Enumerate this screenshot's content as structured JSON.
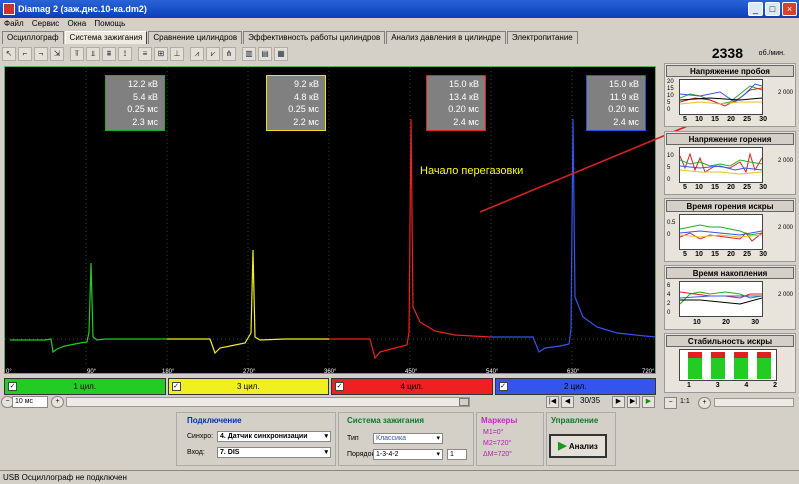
{
  "window": {
    "title": "Diamag 2 (заж.днс.10-ка.dm2)",
    "icon": "app-icon"
  },
  "menu": [
    "Файл",
    "Сервис",
    "Окна",
    "Помощь"
  ],
  "tabs": [
    {
      "label": "Осциллограф",
      "active": false
    },
    {
      "label": "Система зажигания",
      "active": true
    },
    {
      "label": "Сравнение цилиндров",
      "active": false
    },
    {
      "label": "Эффективность работы цилиндров",
      "active": false
    },
    {
      "label": "Анализ давления в цилиндре",
      "active": false
    },
    {
      "label": "Электропитание",
      "active": false
    }
  ],
  "rpm": {
    "value": "2338",
    "unit": "об./мин."
  },
  "scope": {
    "annotation": "Начало перегазовки",
    "info_boxes": [
      {
        "lines": [
          "12.2 кВ",
          "5.4 кВ",
          "0.25 мс",
          "2.3 мс"
        ],
        "border": "#1faa1f"
      },
      {
        "lines": [
          "9.2 кВ",
          "4.8 кВ",
          "0.25 мс",
          "2.2 мс"
        ],
        "border": "#e8e020"
      },
      {
        "lines": [
          "15.0 кВ",
          "13.4 кВ",
          "0.20 мс",
          "2.4 мс"
        ],
        "border": "#e02020"
      },
      {
        "lines": [
          "15.0 кВ",
          "11.9 кВ",
          "0.20 мс",
          "2.4 мс"
        ],
        "border": "#3050e0"
      }
    ],
    "x_ticks": [
      "0°",
      "90°",
      "180°",
      "270°",
      "360°",
      "450°",
      "540°",
      "630°",
      "720°"
    ]
  },
  "cylinders": [
    {
      "label": "1 цил.",
      "color": "#22cc22",
      "checked": "✓"
    },
    {
      "label": "3 цил.",
      "color": "#f0f020",
      "checked": "✓"
    },
    {
      "label": "4 цил.",
      "color": "#ee2020",
      "checked": "✓"
    },
    {
      "label": "2 цил.",
      "color": "#3355ee",
      "checked": "✓"
    }
  ],
  "nav": {
    "time": "10 мс",
    "frames": "30/35"
  },
  "right_panels": [
    {
      "title": "Напряжение пробоя",
      "y_ticks": [
        "20",
        "15",
        "10",
        "5",
        "0"
      ],
      "x_ticks": [
        "5",
        "10",
        "15",
        "20",
        "25",
        "30"
      ],
      "right": "2 000"
    },
    {
      "title": "Напряжение горения",
      "y_ticks": [
        "10",
        "5",
        "0"
      ],
      "x_ticks": [
        "5",
        "10",
        "15",
        "20",
        "25",
        "30"
      ],
      "right": "2 000"
    },
    {
      "title": "Время горения искры",
      "y_ticks": [
        "",
        "0.5",
        "0"
      ],
      "x_ticks": [
        "5",
        "10",
        "15",
        "20",
        "25",
        "30"
      ],
      "right": "2 000"
    },
    {
      "title": "Время накопления",
      "y_ticks": [
        "6",
        "4",
        "2",
        "0"
      ],
      "x_ticks": [
        "10",
        "20",
        "30"
      ],
      "right": "2 000"
    },
    {
      "title": "Стабильность искры",
      "y_ticks": [],
      "x_ticks": [
        "1",
        "3",
        "4",
        "2"
      ],
      "right": ""
    }
  ],
  "zoom": "1:1",
  "bottom": {
    "connection_title": "Подключение",
    "sync_label": "Синхро:",
    "sync_value": "4.  Датчик синхронизации",
    "input_label": "Вход:",
    "input_value": "7.  DIS",
    "ignition_title": "Система зажигания",
    "type_label": "Тип",
    "type_value": "Классика",
    "order_label": "Порядок",
    "order_value": "1-3-4-2",
    "order_num": "1",
    "markers_title": "Маркеры",
    "m1": "M1=0°",
    "m2": "M2=720°",
    "dm": "ΔM=720°",
    "control_title": "Управление",
    "analyze_label": "Анализ"
  },
  "status": "USB Осциллограф не подключен"
}
